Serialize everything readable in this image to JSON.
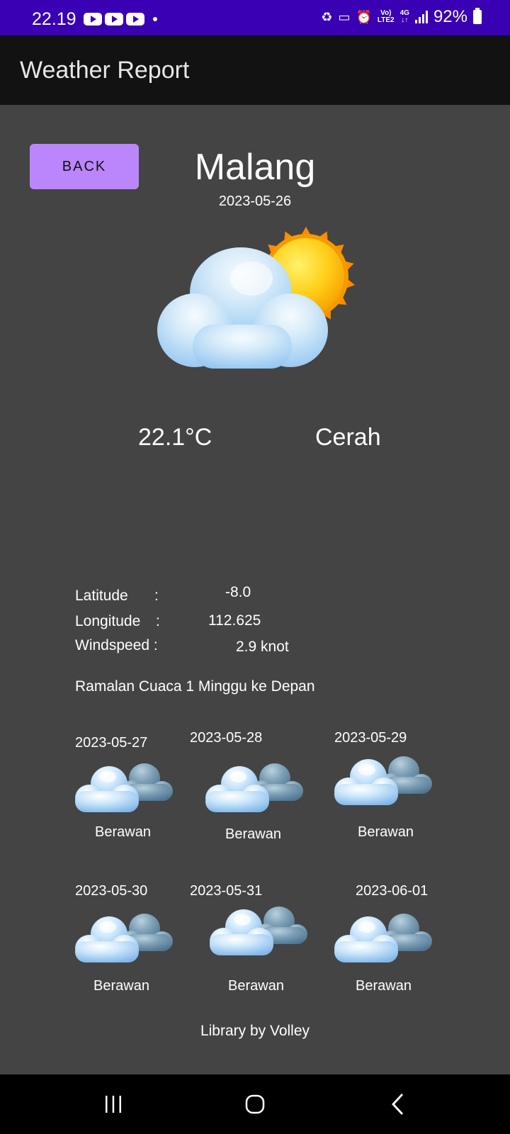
{
  "status_bar": {
    "time": "22.19",
    "battery": "92%"
  },
  "app_bar": {
    "title": "Weather Report"
  },
  "back_button": {
    "label": "BACK"
  },
  "current": {
    "city": "Malang",
    "date": "2023-05-26",
    "temperature": "22.1°C",
    "condition": "Cerah",
    "icon": "partly-sunny-cloud-icon"
  },
  "details": {
    "latitude_label": "Latitude",
    "latitude_sep": ":",
    "latitude_value": "-8.0",
    "longitude_label": "Longitude",
    "longitude_sep": ":",
    "longitude_value": "112.625",
    "windspeed_label": "Windspeed :",
    "windspeed_value": "2.9 knot"
  },
  "forecast_title": "Ramalan Cuaca 1 Minggu ke Depan",
  "forecast": [
    {
      "date": "2023-05-27",
      "condition": "Berawan",
      "icon": "cloudy-icon"
    },
    {
      "date": "2023-05-28",
      "condition": "Berawan",
      "icon": "cloudy-icon"
    },
    {
      "date": "2023-05-29",
      "condition": "Berawan",
      "icon": "cloudy-icon"
    },
    {
      "date": "2023-05-30",
      "condition": "Berawan",
      "icon": "cloudy-icon"
    },
    {
      "date": "2023-05-31",
      "condition": "Berawan",
      "icon": "cloudy-icon"
    },
    {
      "date": "2023-06-01",
      "condition": "Berawan",
      "icon": "cloudy-icon"
    }
  ],
  "footer": "Library by Volley",
  "colors": {
    "status_bar": "#3a00b4",
    "app_bar": "#121212",
    "background": "#444444",
    "button": "#bb86fc",
    "nav_bar": "#000000"
  }
}
